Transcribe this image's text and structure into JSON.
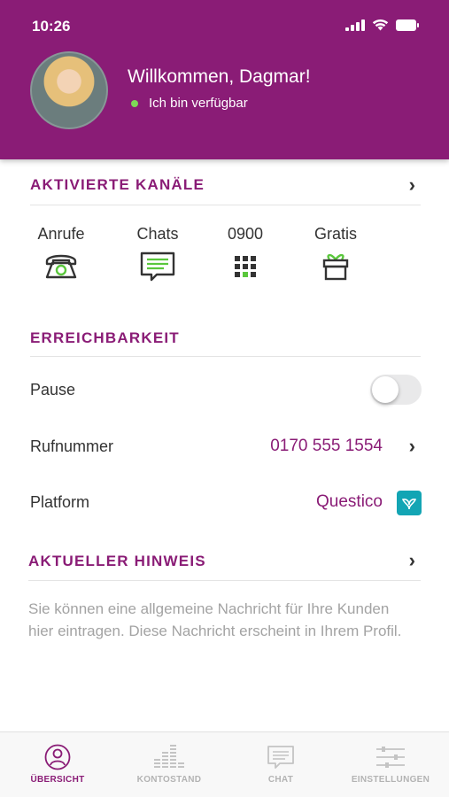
{
  "status_bar": {
    "time": "10:26"
  },
  "header": {
    "welcome": "Willkommen, Dagmar!",
    "availability": "Ich bin verfügbar",
    "availability_color": "#7ed957",
    "brand_color": "#8a1c76"
  },
  "channels": {
    "title": "AKTIVIERTE KANÄLE",
    "items": [
      {
        "label": "Anrufe",
        "icon": "phone-icon"
      },
      {
        "label": "Chats",
        "icon": "chat-icon"
      },
      {
        "label": "0900",
        "icon": "keypad-icon"
      },
      {
        "label": "Gratis",
        "icon": "gift-icon"
      }
    ]
  },
  "reachability": {
    "title": "ERREICHBARKEIT",
    "pause_label": "Pause",
    "pause_enabled": false,
    "phone_label": "Rufnummer",
    "phone_value": "0170 555 1554",
    "platform_label": "Platform",
    "platform_value": "Questico",
    "platform_color": "#13a5b4"
  },
  "notice": {
    "title": "AKTUELLER HINWEIS",
    "text": "Sie können eine allgemeine Nachricht für Ihre Kunden hier eintragen. Diese Nachricht erscheint in Ihrem Profil."
  },
  "tabbar": {
    "items": [
      {
        "label": "ÜBERSICHT",
        "icon": "user-circle-icon",
        "active": true
      },
      {
        "label": "KONTOSTAND",
        "icon": "equalizer-icon",
        "active": false
      },
      {
        "label": "CHAT",
        "icon": "chat-bubble-icon",
        "active": false
      },
      {
        "label": "EINSTELLUNGEN",
        "icon": "sliders-icon",
        "active": false
      }
    ]
  }
}
